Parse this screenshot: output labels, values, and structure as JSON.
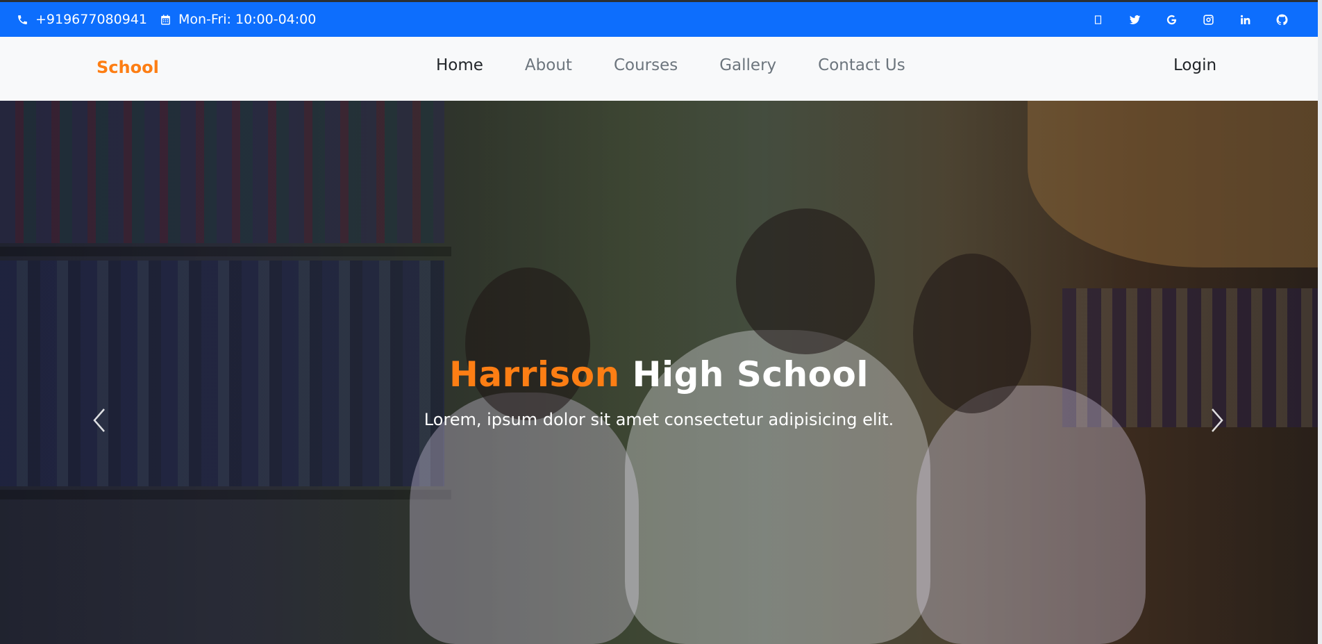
{
  "topbar": {
    "phone": "+919677080941",
    "hours": "Mon-Fri: 10:00-04:00",
    "social_icons": [
      "square-icon",
      "twitter-icon",
      "google-icon",
      "instagram-icon",
      "linkedin-icon",
      "github-icon"
    ]
  },
  "nav": {
    "brand": "School",
    "items": [
      {
        "label": "Home",
        "active": true
      },
      {
        "label": "About",
        "active": false
      },
      {
        "label": "Courses",
        "active": false
      },
      {
        "label": "Gallery",
        "active": false
      },
      {
        "label": "Contact Us",
        "active": false
      }
    ],
    "login": "Login"
  },
  "hero": {
    "title_highlight": "Harrison",
    "title_rest": "High School",
    "subtitle": "Lorem, ipsum dolor sit amet consectetur adipisicing elit."
  },
  "colors": {
    "topbar_bg": "#0d6efd",
    "brand_accent": "#fd7e14",
    "nav_bg": "#f8f9fa"
  }
}
